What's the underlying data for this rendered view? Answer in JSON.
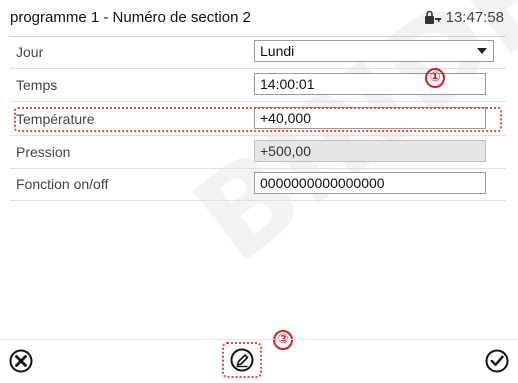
{
  "header": {
    "title": "programme 1 - Numéro de section 2",
    "time": "13:47:58"
  },
  "rows": [
    {
      "label": "Jour",
      "value": "Lundi"
    },
    {
      "label": "Temps",
      "value": "14:00:01"
    },
    {
      "label": "Température",
      "value": "+40,000"
    },
    {
      "label": "Pression",
      "value": "+500,00"
    },
    {
      "label": "Fonction on/off",
      "value": "0000000000000000"
    }
  ],
  "markers": [
    "①",
    "②"
  ],
  "watermark": "BINDER",
  "icons": {
    "lock": "lock-icon",
    "cancel": "cancel-x-icon",
    "edit": "pencil-edit-icon",
    "confirm": "checkmark-icon"
  },
  "colors": {
    "highlight": "#e04848",
    "marker": "#d62020",
    "disabled_field": "#e6e6e6"
  }
}
